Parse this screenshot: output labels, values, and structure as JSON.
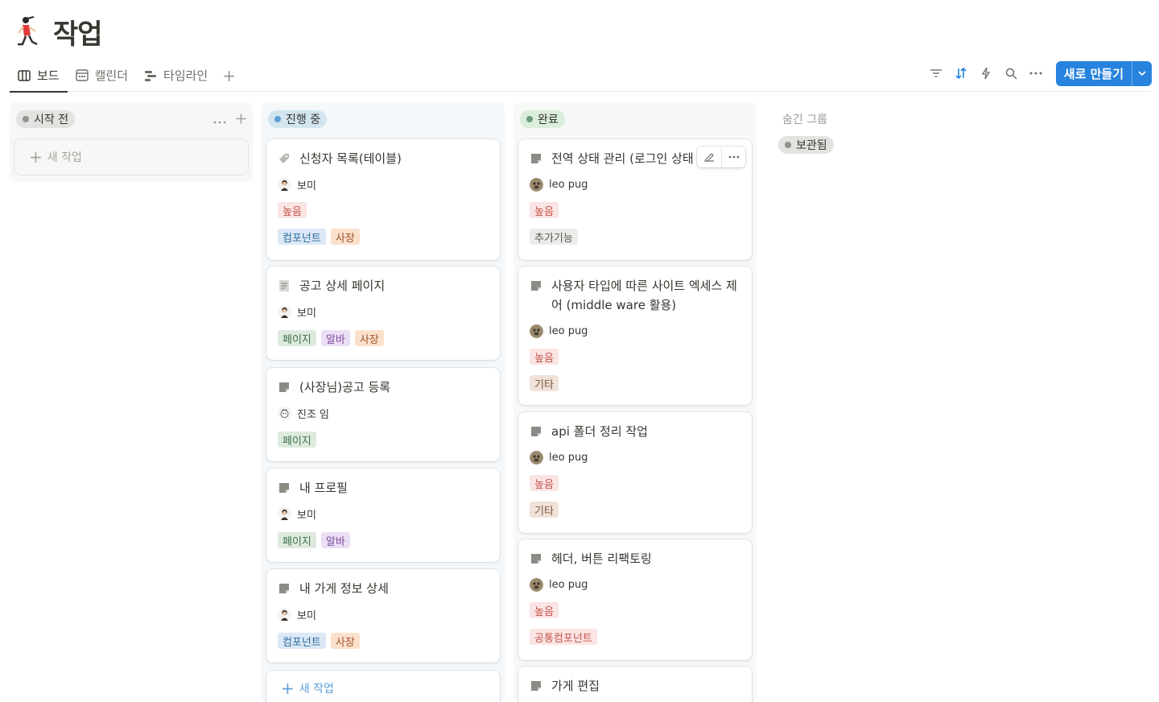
{
  "page": {
    "title": "작업"
  },
  "views": {
    "tabs": [
      {
        "label": "보드",
        "icon": "board-icon",
        "active": true
      },
      {
        "label": "캘린더",
        "icon": "calendar-icon",
        "active": false
      },
      {
        "label": "타임라인",
        "icon": "timeline-icon",
        "active": false
      }
    ],
    "add_view": "+"
  },
  "toolbar": {
    "icons": [
      "filter-icon",
      "sort-icon",
      "automation-icon",
      "search-icon",
      "more-icon"
    ],
    "new_button": "새로 만들기",
    "accent": "#2783de"
  },
  "colors": {
    "tag_red": {
      "bg": "#fbe4e4",
      "fg": "#c4554d"
    },
    "tag_blue": {
      "bg": "#dbe8f5",
      "fg": "#2c6b9e"
    },
    "tag_orange": {
      "bg": "#fbe1cc",
      "fg": "#a0532a"
    },
    "tag_green": {
      "bg": "#dfeadf",
      "fg": "#3b7348"
    },
    "tag_purple": {
      "bg": "#ebdff5",
      "fg": "#7b4c9e"
    },
    "tag_gray": {
      "bg": "#ececeb",
      "fg": "#55534e"
    },
    "tag_brown": {
      "bg": "#f0e2d9",
      "fg": "#7a553a"
    }
  },
  "board": {
    "columns": [
      {
        "label": "시작 전",
        "dot": "#91918e",
        "pill_bg": "#e3e2e0",
        "col_bg": "#f7f7f5",
        "new_task": "새 작업",
        "cards": []
      },
      {
        "label": "진행 중",
        "dot": "#5e9fd6",
        "pill_bg": "#d3e5ef",
        "col_bg": "#f5f8fb",
        "new_task": "새 작업",
        "cards": [
          {
            "title": "신청자 목록(테이블)",
            "icon": "tag-icon",
            "person": "보미",
            "priority": "높음",
            "tags": [
              {
                "label": "컴포넌트",
                "color": "tag_blue"
              },
              {
                "label": "사장",
                "color": "tag_orange"
              }
            ]
          },
          {
            "title": "공고 상세 페이지",
            "icon": "document-icon",
            "person": "보미",
            "priority": "",
            "tags": [
              {
                "label": "페이지",
                "color": "tag_green"
              },
              {
                "label": "알바",
                "color": "tag_purple"
              },
              {
                "label": "사장",
                "color": "tag_orange"
              }
            ]
          },
          {
            "title": "(사장님)공고 등록",
            "icon": "page-icon",
            "person": "진조 임",
            "priority": "",
            "tags": [
              {
                "label": "페이지",
                "color": "tag_green"
              }
            ]
          },
          {
            "title": "내 프로필",
            "icon": "page-icon",
            "person": "보미",
            "priority": "",
            "tags": [
              {
                "label": "페이지",
                "color": "tag_green"
              },
              {
                "label": "알바",
                "color": "tag_purple"
              }
            ]
          },
          {
            "title": "내 가게 정보 상세",
            "icon": "page-icon",
            "person": "보미",
            "priority": "",
            "tags": [
              {
                "label": "컴포넌트",
                "color": "tag_blue"
              },
              {
                "label": "사장",
                "color": "tag_orange"
              }
            ]
          }
        ]
      },
      {
        "label": "완료",
        "dot": "#6c9b7d",
        "pill_bg": "#dbeddb",
        "col_bg": "#f6f9f6",
        "cards": [
          {
            "title": "전역 상태 관리 (로그인 상태",
            "icon": "page-icon",
            "person": "leo pug",
            "priority": "높음",
            "tags": [
              {
                "label": "추가기능",
                "color": "tag_gray"
              }
            ]
          },
          {
            "title": "사용자 타입에 따른 사이트 엑세스 제어 (middle ware 활용)",
            "icon": "page-icon",
            "person": "leo pug",
            "priority": "높음",
            "tags": [
              {
                "label": "기타",
                "color": "tag_brown"
              }
            ]
          },
          {
            "title": "api 폴더 정리 작업",
            "icon": "page-icon",
            "person": "leo pug",
            "priority": "높음",
            "tags": [
              {
                "label": "기타",
                "color": "tag_brown"
              }
            ]
          },
          {
            "title": "헤더, 버튼 리팩토링",
            "icon": "page-icon",
            "person": "leo pug",
            "priority": "높음",
            "tags": [
              {
                "label": "공통컴포넌트",
                "color": "tag_red"
              }
            ]
          },
          {
            "title": "가게 편집",
            "icon": "page-icon",
            "person": "",
            "priority": "",
            "tags": []
          }
        ]
      }
    ],
    "hidden": {
      "label": "숨긴 그룹",
      "groups": [
        {
          "label": "보관됨",
          "dot": "#91918e",
          "pill_bg": "#e3e2e0"
        }
      ]
    }
  }
}
